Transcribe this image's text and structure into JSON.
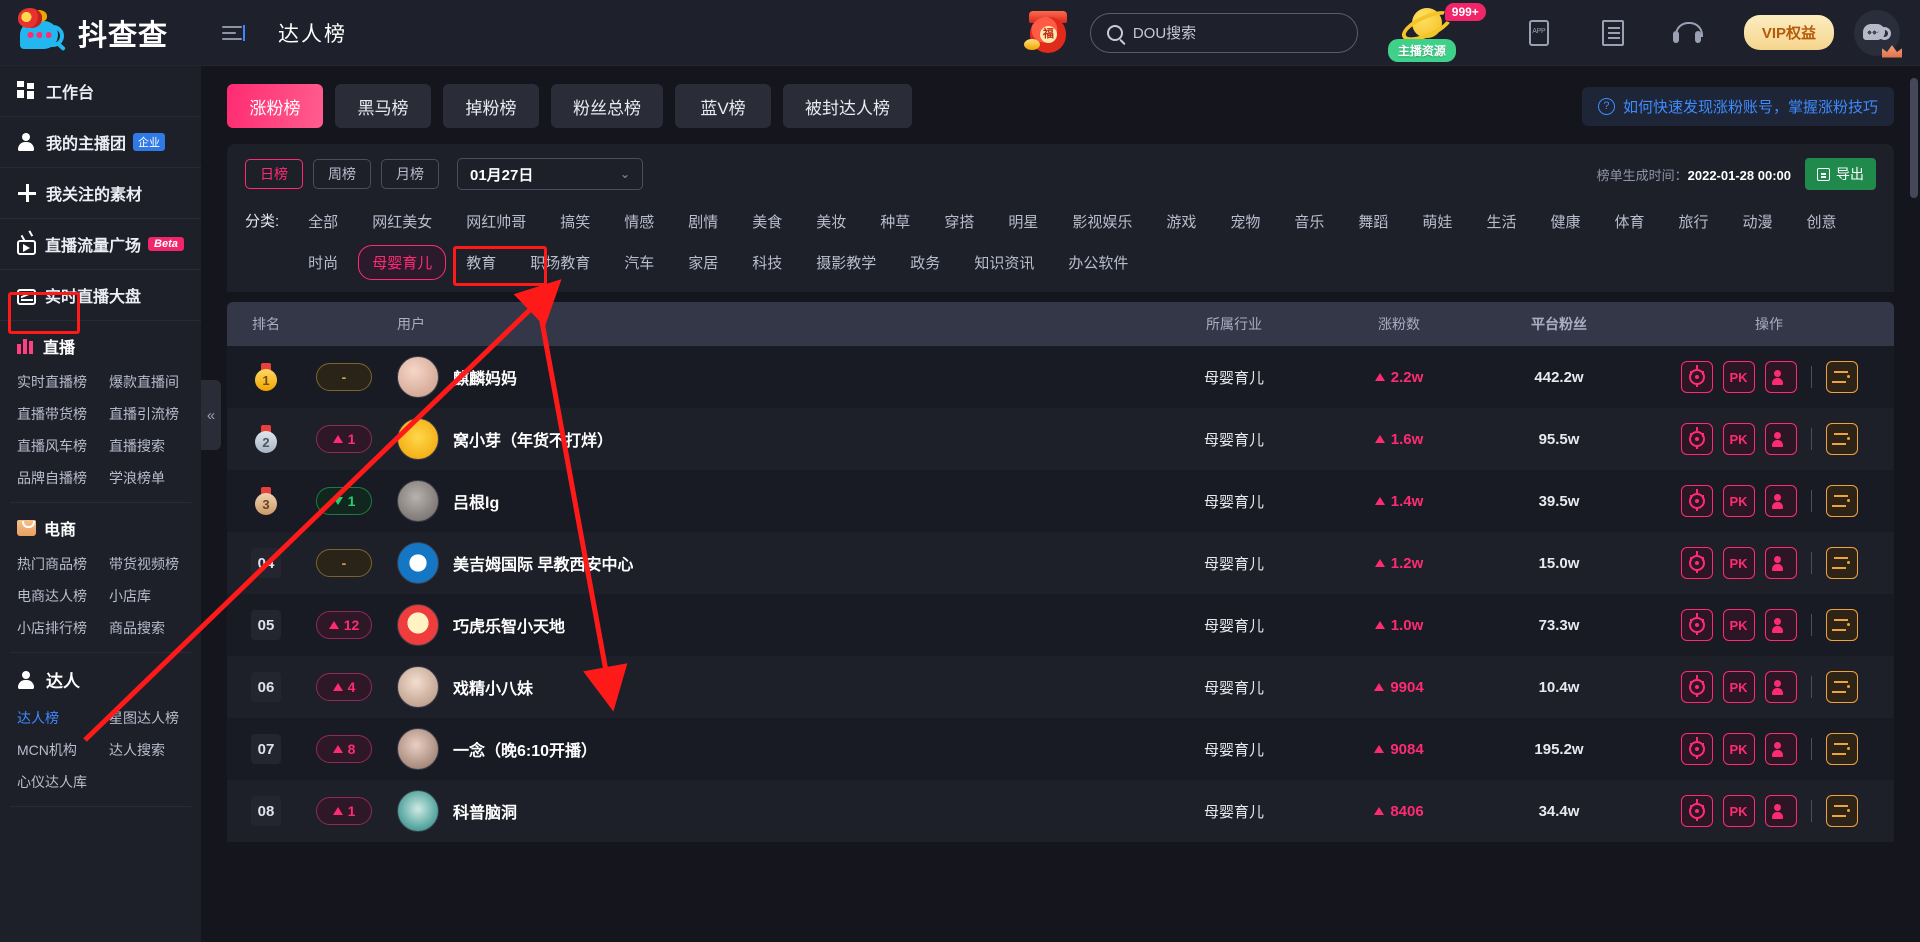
{
  "header": {
    "brand": "抖查查",
    "page_title": "达人榜",
    "search_placeholder": "DOU搜索",
    "lucky_bag_text": "福",
    "planet_count": "999+",
    "planet_label": "主播资源",
    "vip_label": "VIP权益",
    "icons": [
      "app-icon",
      "doc-icon",
      "headphone-icon",
      "vip-badge",
      "avatar"
    ]
  },
  "sidebar": {
    "top_items": [
      {
        "label": "工作台",
        "icon": "grid-icon",
        "tag": ""
      },
      {
        "label": "我的主播团",
        "icon": "person-icon",
        "tag": "企业"
      },
      {
        "label": "我关注的素材",
        "icon": "plus-icon",
        "tag": ""
      },
      {
        "label": "直播流量广场",
        "icon": "tv-icon",
        "tag": "Beta"
      },
      {
        "label": "实时直播大盘",
        "icon": "chart-icon",
        "tag": ""
      }
    ],
    "sections": [
      {
        "title": "直播",
        "icon": "bars-icon",
        "items": [
          "实时直播榜",
          "爆款直播间",
          "直播带货榜",
          "直播引流榜",
          "直播风车榜",
          "直播搜索",
          "品牌自播榜",
          "学浪榜单"
        ]
      },
      {
        "title": "电商",
        "icon": "shop-icon",
        "items": [
          "热门商品榜",
          "带货视频榜",
          "电商达人榜",
          "小店库",
          "小店排行榜",
          "商品搜索"
        ]
      },
      {
        "title": "达人",
        "icon": "person-icon",
        "items": [
          "达人榜",
          "星图达人榜",
          "MCN机构",
          "达人搜索",
          "心仪达人库"
        ],
        "active_item": "达人榜"
      }
    ],
    "collapse_glyph": "«"
  },
  "main": {
    "tabs": [
      {
        "label": "涨粉榜",
        "active": true
      },
      {
        "label": "黑马榜",
        "active": false
      },
      {
        "label": "掉粉榜",
        "active": false
      },
      {
        "label": "粉丝总榜",
        "active": false
      },
      {
        "label": "蓝V榜",
        "active": false
      },
      {
        "label": "被封达人榜",
        "active": false
      }
    ],
    "help_link": "如何快速发现涨粉账号，掌握涨粉技巧",
    "period_segments": [
      {
        "label": "日榜",
        "active": true
      },
      {
        "label": "周榜",
        "active": false
      },
      {
        "label": "月榜",
        "active": false
      }
    ],
    "date_value": "01月27日",
    "generated_label": "榜单生成时间：",
    "generated_time": "2022-01-28 00:00",
    "export_label": "导出",
    "category_label": "分类:",
    "categories": [
      "全部",
      "网红美女",
      "网红帅哥",
      "搞笑",
      "情感",
      "剧情",
      "美食",
      "美妆",
      "种草",
      "穿搭",
      "明星",
      "影视娱乐",
      "游戏",
      "宠物",
      "音乐",
      "舞蹈",
      "萌娃",
      "生活",
      "健康",
      "体育",
      "旅行",
      "动漫",
      "创意",
      "时尚",
      "母婴育儿",
      "教育",
      "职场教育",
      "汽车",
      "家居",
      "科技",
      "摄影教学",
      "政务",
      "知识资讯",
      "办公软件"
    ],
    "active_category": "母婴育儿",
    "table": {
      "columns": [
        "排名",
        "用户",
        "所属行业",
        "涨粉数",
        "平台粉丝",
        "操作"
      ],
      "rows": [
        {
          "rank": "1",
          "medal": true,
          "delta": "-",
          "delta_dir": "flat",
          "name": "麒麟妈妈",
          "industry": "母婴育儿",
          "gain": "2.2w",
          "gain_dir": "up",
          "fans": "442.2w"
        },
        {
          "rank": "2",
          "medal": true,
          "delta": "1",
          "delta_dir": "up",
          "name": "窝小芽（年货不打烊）",
          "industry": "母婴育儿",
          "gain": "1.6w",
          "gain_dir": "up",
          "fans": "95.5w"
        },
        {
          "rank": "3",
          "medal": true,
          "delta": "1",
          "delta_dir": "down",
          "name": "吕根lg",
          "industry": "母婴育儿",
          "gain": "1.4w",
          "gain_dir": "up",
          "fans": "39.5w"
        },
        {
          "rank": "04",
          "medal": false,
          "delta": "-",
          "delta_dir": "flat",
          "name": "美吉姆国际 早教西安中心",
          "industry": "母婴育儿",
          "gain": "1.2w",
          "gain_dir": "up",
          "fans": "15.0w"
        },
        {
          "rank": "05",
          "medal": false,
          "delta": "12",
          "delta_dir": "up",
          "name": "巧虎乐智小天地",
          "industry": "母婴育儿",
          "gain": "1.0w",
          "gain_dir": "up",
          "fans": "73.3w"
        },
        {
          "rank": "06",
          "medal": false,
          "delta": "4",
          "delta_dir": "up",
          "name": "戏精小八妹",
          "industry": "母婴育儿",
          "gain": "9904",
          "gain_dir": "up",
          "fans": "10.4w"
        },
        {
          "rank": "07",
          "medal": false,
          "delta": "8",
          "delta_dir": "up",
          "name": "一念（晚6:10开播）",
          "industry": "母婴育儿",
          "gain": "9084",
          "gain_dir": "up",
          "fans": "195.2w"
        },
        {
          "rank": "08",
          "medal": false,
          "delta": "1",
          "delta_dir": "up",
          "name": "科普脑洞",
          "industry": "母婴育儿",
          "gain": "8406",
          "gain_dir": "up",
          "fans": "34.4w"
        }
      ],
      "action_icons": [
        "target-icon",
        "pk-icon",
        "users-icon",
        "list-icon"
      ],
      "pk_label": "PK"
    }
  },
  "colors": {
    "accent_pink": "#ff2b72",
    "bg_dark": "#14151d",
    "panel": "#1d1f29",
    "sidebar": "#1d1f29",
    "green": "#25cf71",
    "orange": "#f0a33c",
    "annotation_red": "#ff1a1a"
  }
}
